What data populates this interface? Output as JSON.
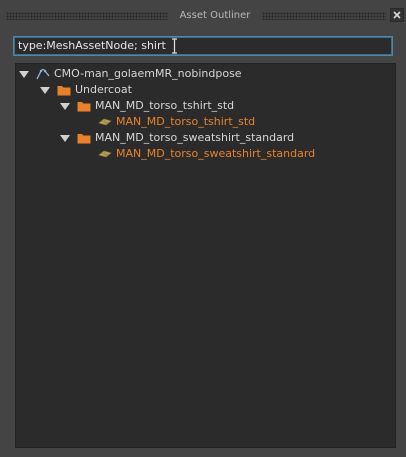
{
  "window": {
    "title": "Asset Outliner"
  },
  "filter": {
    "value": "type:MeshAssetNode; shirt"
  },
  "tree": {
    "root": {
      "label": "CMO-man_golaemMR_nobindpose",
      "icon": "skeleton-icon",
      "expanded": true
    },
    "group": {
      "label": "Undercoat",
      "icon": "folder-icon",
      "expanded": true
    },
    "subgroups": [
      {
        "label": "MAN_MD_torso_tshirt_std",
        "icon": "folder-icon",
        "expanded": true,
        "child": {
          "label": "MAN_MD_torso_tshirt_std",
          "icon": "mesh-icon"
        }
      },
      {
        "label": "MAN_MD_torso_sweatshirt_standard",
        "icon": "folder-icon",
        "expanded": true,
        "child": {
          "label": "MAN_MD_torso_sweatshirt_standard",
          "icon": "mesh-icon"
        }
      }
    ]
  },
  "colors": {
    "accent": "#5285a6",
    "mesh_text": "#e8822a",
    "folder": "#e8822a",
    "panel_bg": "#2b2b2b",
    "chrome_bg": "#444444"
  }
}
